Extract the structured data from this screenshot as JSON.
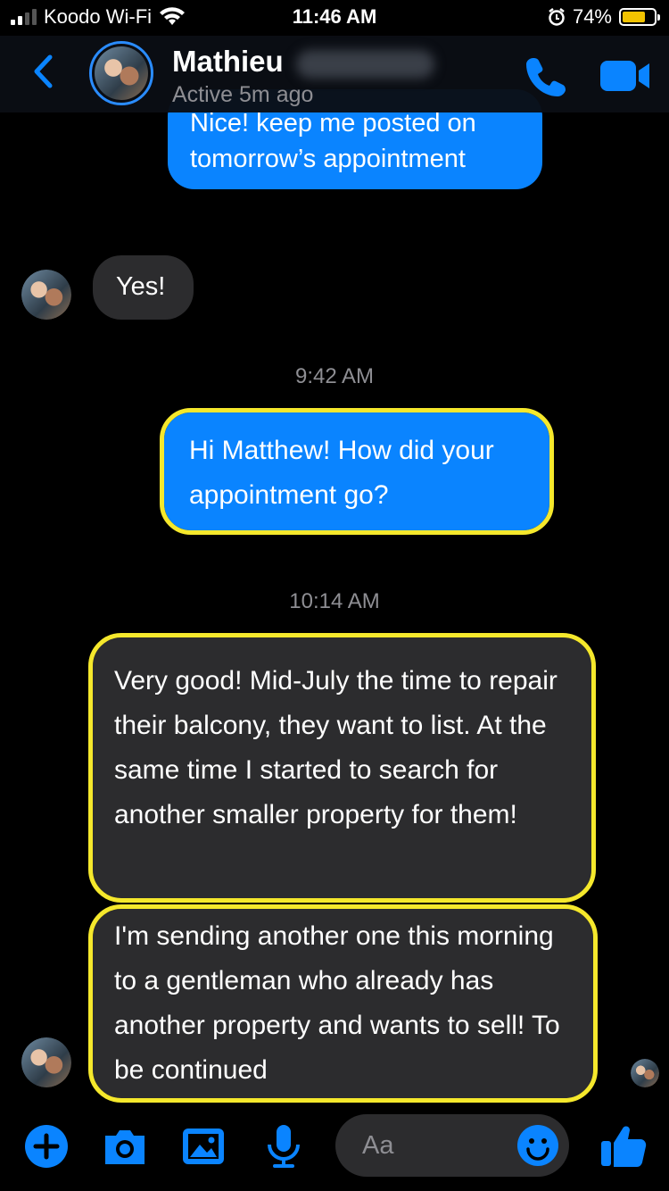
{
  "status_bar": {
    "carrier": "Koodo Wi-Fi",
    "time": "11:46 AM",
    "battery": "74%",
    "battery_level": 0.74,
    "icons": [
      "signal-icon",
      "wifi-icon",
      "alarm-icon",
      "battery-icon"
    ]
  },
  "header": {
    "name": "Mathieu",
    "status": "Active 5m ago",
    "back_icon": "chevron-left-icon",
    "call_icon": "phone-icon",
    "video_icon": "video-camera-icon"
  },
  "messages": [
    {
      "type": "outgoing",
      "text": "Nice! keep me posted on tomorrow’s appointment"
    },
    {
      "type": "incoming",
      "text": "Yes!"
    },
    {
      "type": "timestamp",
      "text": "9:42 AM"
    },
    {
      "type": "outgoing",
      "text": "Hi Matthew! How did your appointment go?",
      "highlighted": true
    },
    {
      "type": "timestamp",
      "text": "10:14 AM"
    },
    {
      "type": "incoming",
      "text": "Very good! Mid-July the time to repair their balcony, they want to list. At the same time I started to search for another smaller property for them!",
      "highlighted": true
    },
    {
      "type": "incoming",
      "text": "I'm sending another one this morning to a gentleman who already has another property and wants to sell! To be continued",
      "highlighted": true
    }
  ],
  "composer": {
    "placeholder": "Aa",
    "icons": [
      "plus-icon",
      "camera-icon",
      "image-icon",
      "microphone-icon",
      "emoji-icon",
      "thumbs-up-icon"
    ]
  },
  "colors": {
    "accent": "#0a84ff",
    "incoming_bubble": "#2c2c2e",
    "highlight": "#f5e82c",
    "background": "#000000"
  }
}
